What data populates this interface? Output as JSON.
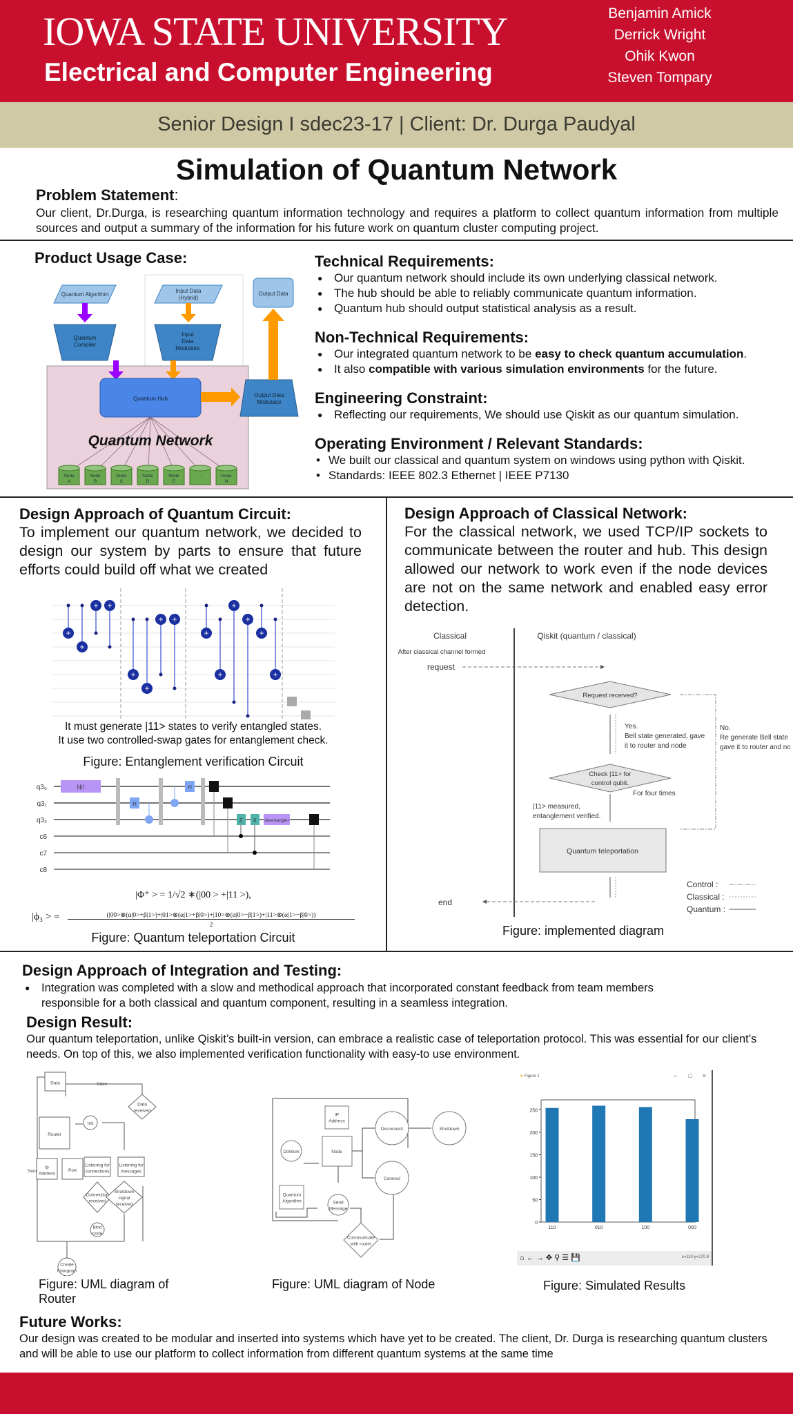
{
  "header": {
    "university": "IOWA STATE UNIVERSITY",
    "department": "Electrical and Computer Engineering",
    "authors": [
      "Benjamin Amick",
      "Derrick Wright",
      "Ohik Kwon",
      "Steven Tompary"
    ],
    "subtitle": "Senior Design I sdec23-17 | Client: Dr. Durga Paudyal",
    "title": "Simulation of Quantum Network",
    "brand_color": "#c8102e",
    "band_color": "#cfc9a6"
  },
  "problem": {
    "heading": "Problem Statement",
    "heading_colon": ":",
    "text": "Our client, Dr.Durga, is researching quantum information technology and requires a platform to collect quantum information from multiple sources and output a summary of the information for his future work on quantum cluster computing project."
  },
  "usage": {
    "heading": "Product Usage Case:",
    "diagram": {
      "quantum_algorithm": "Quantum Algorithm",
      "input_data": [
        "Input Data",
        "(Hybrid)"
      ],
      "output_data": "Output Data",
      "quantum_compiler": [
        "Quantum",
        "Compiler"
      ],
      "input_modulator": [
        "Input",
        "Data",
        "Modulator"
      ],
      "quantum_hub": "Quantum Hub",
      "output_modulator": [
        "Output Data",
        "Modulator"
      ],
      "network_label": "Quantum Network",
      "nodes": [
        [
          "Node",
          "A"
        ],
        [
          "Node",
          "B"
        ],
        [
          "Node",
          "C"
        ],
        [
          "Node",
          "D"
        ],
        [
          "Node",
          "E"
        ],
        [
          "...",
          ""
        ],
        [
          "Node",
          "N"
        ]
      ]
    }
  },
  "requirements": {
    "technical": {
      "heading": "Technical Requirements:",
      "items": [
        "Our quantum network should include its own underlying classical network.",
        "The hub should be able to reliably communicate quantum information.",
        "Quantum hub should output statistical analysis as a result."
      ]
    },
    "non_technical": {
      "heading": "Non-Technical Requirements:",
      "items": [
        {
          "pre": "Our integrated quantum network to be ",
          "bold": "easy to check quantum accumulation",
          "post": "."
        },
        {
          "pre": "It also ",
          "bold": "compatible with various simulation environments",
          "post": " for the future."
        }
      ]
    },
    "constraint": {
      "heading": "Engineering Constraint:",
      "items": [
        "Reflecting our requirements, We should use Qiskit as our quantum simulation."
      ]
    },
    "environment": {
      "heading": "Operating Environment / Relevant Standards:",
      "items": [
        "We built our classical and quantum system on windows using python with Qiskit.",
        "Standards: IEEE 802.3 Ethernet | IEEE P7130"
      ]
    }
  },
  "quantum_circuit": {
    "heading": "Design Approach of Quantum Circuit:",
    "text": "To implement our quantum network, we decided to design our system by parts to ensure that future efforts could build off what we created",
    "note1": "It must generate |11> states to verify entangled states.",
    "note2": "It use two controlled-swap gates for entanglement check.",
    "caption1": "Figure: Entanglement verification Circuit",
    "teleport_labels": {
      "qubits": [
        "q3₀",
        "q3₁",
        "q3₂"
      ],
      "cbits": [
        "c6",
        "c7",
        "c8"
      ],
      "gates": {
        "psi": "|ψ⟩",
        "h": "H",
        "z": "Z",
        "x": "X",
        "disentangler": "disentangler"
      }
    },
    "equation1": "|Φ⁺ > = 1/√2 ∗(|00 > +|11 >),",
    "equation2_lhs": "|ϕ₃ > =",
    "equation2_num": "(|00>⊗(α|0>+β|1>)+|01>⊗(α|1>+β|0>)+|10>⊗(α|0>−β|1>)+|11>⊗(α|1>−β|0>))",
    "equation2_den": "2",
    "caption2": "Figure: Quantum teleportation Circuit"
  },
  "classical_network": {
    "heading": "Design Approach of Classical Network:",
    "text": "For the classical network, we used TCP/IP sockets to communicate between the router and hub. This design allowed our network to work even if the node devices are not on the same network and enabled easy error detection.",
    "diagram": {
      "col_classical": "Classical",
      "col_qiskit": "Qiskit (quantum / classical)",
      "after": "After classical channel formed",
      "request": "request",
      "request_received": "Request received?",
      "yes": [
        "Yes.",
        "Bell state generated, gave",
        "it to router and node"
      ],
      "no": [
        "No.",
        "Re generate Bell state and",
        "gave it to router and node"
      ],
      "check": [
        "Check |11> for",
        "control qubit."
      ],
      "four_times": "For four times",
      "measured": [
        "|11> measured,",
        "entanglement verified."
      ],
      "teleport": "Quantum teleportation",
      "end": "end",
      "legend": [
        "Control :",
        "Classical :",
        "Quantum :"
      ]
    },
    "caption": "Figure: implemented diagram"
  },
  "integration": {
    "heading": "Design Approach of Integration and Testing:",
    "items": [
      "Integration was completed with a slow and methodical approach that incorporated constant feedback from team members responsible for a both classical and quantum component, resulting in a seamless integration."
    ]
  },
  "result": {
    "heading": "Design Result:",
    "text": "Our quantum teleportation, unlike Qiskit’s built-in version, can embrace a realistic case of teleportation protocol. This was essential for our client’s needs. On top of this, we also implemented verification functionality with easy-to use environment."
  },
  "router_uml": {
    "labels": {
      "data": "Data",
      "store": "Store",
      "data_received": [
        "Data",
        "received"
      ],
      "router": "Router",
      "init": "Init",
      "send": "Send",
      "ip": [
        "Ip",
        "Address"
      ],
      "port": "Port",
      "listen_conn": [
        "Listening for",
        "connections"
      ],
      "listen_msg": [
        "Listening for",
        "messages"
      ],
      "conn_recv": [
        "Connection",
        "received"
      ],
      "shutdown_sig": [
        "Shutdown",
        "signal",
        "received"
      ],
      "bind": [
        "Bind",
        "node"
      ],
      "histogram": [
        "Create",
        "histogram"
      ]
    },
    "caption": "Figure: UML diagram of Router"
  },
  "node_uml": {
    "labels": {
      "ip": [
        "IP",
        "Address"
      ],
      "disconnect": "Disconnect",
      "shutdown": "Shutdown",
      "dowork": "DoWork",
      "node": "Node",
      "connect": "Connect",
      "qalgo": [
        "Quantum",
        "Algorithm"
      ],
      "send": [
        "Send",
        "Message"
      ],
      "communicate": [
        "Communicate",
        "with router"
      ]
    },
    "caption": "Figure: UML diagram of Node"
  },
  "sim_window": {
    "title": "Figure 1",
    "status": "x=110 y=270.9",
    "caption": "Figure: Simulated Results",
    "bar_color": "#1f77b4"
  },
  "chart_data": {
    "type": "bar",
    "title": "",
    "categories": [
      "110",
      "010",
      "100",
      "000"
    ],
    "values": [
      254,
      259,
      256,
      229
    ],
    "xlabel": "",
    "ylabel": "",
    "ylim": [
      0,
      272
    ],
    "yticks": [
      0,
      50,
      100,
      150,
      200,
      250
    ],
    "grid": false
  },
  "future": {
    "heading": "Future Works:",
    "text": "Our design was created to be modular and inserted into systems which have yet to be created. The client, Dr. Durga is researching quantum clusters and will be able to use our platform to collect information from different quantum systems at the same time"
  }
}
